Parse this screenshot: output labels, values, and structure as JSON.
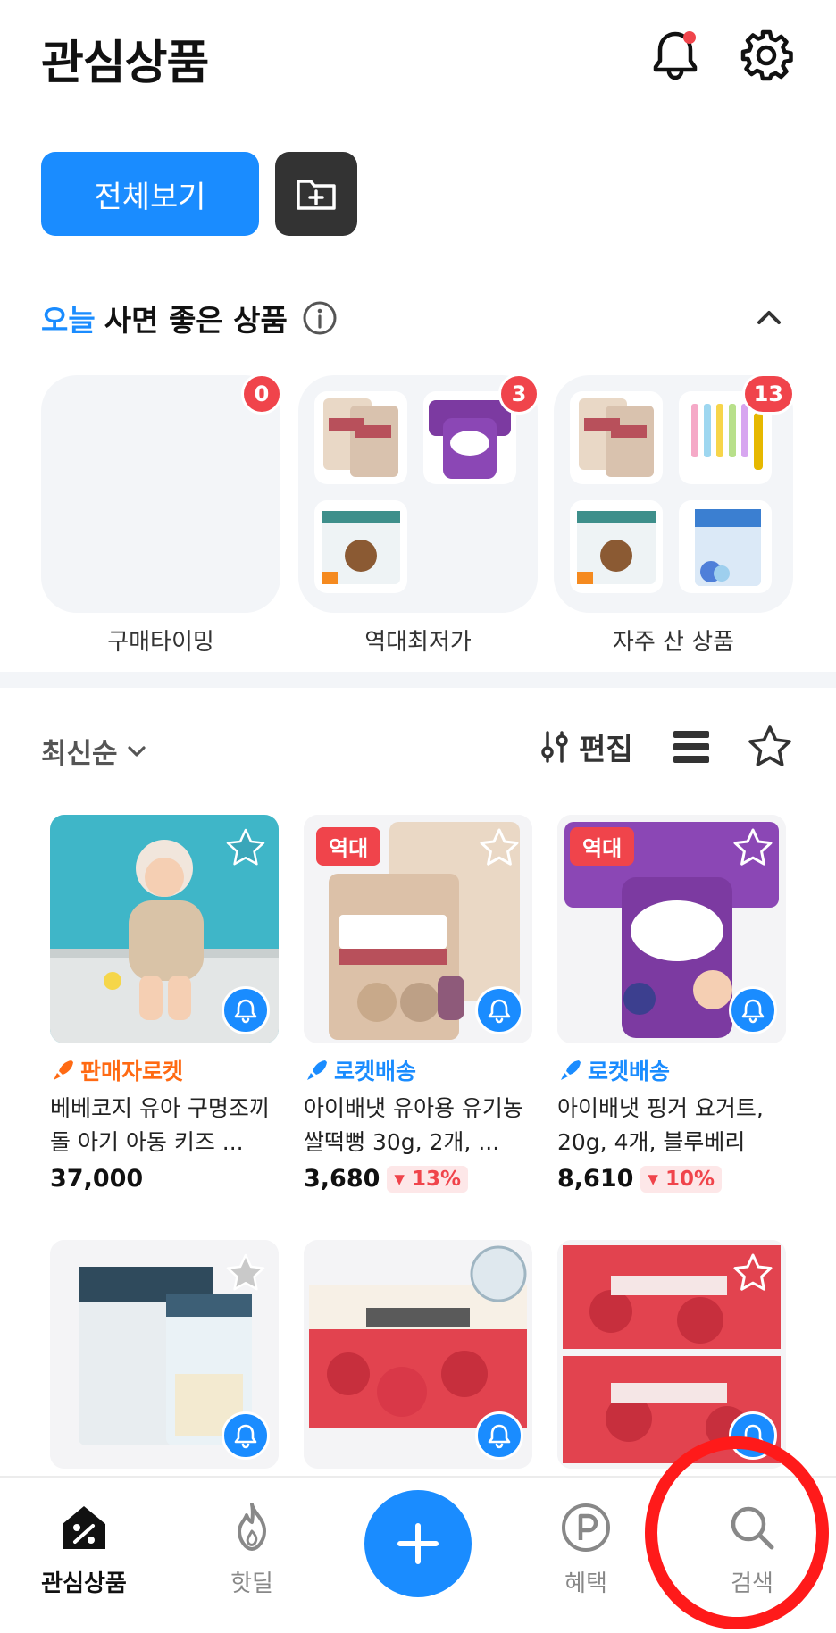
{
  "header": {
    "title": "관심상품",
    "notification_dot_color": "#f0444b"
  },
  "filters": {
    "all_label": "전체보기"
  },
  "today": {
    "title_accent": "오늘",
    "title_rest": "사면 좋은 상품",
    "cards": [
      {
        "label": "구매타이밍",
        "count": "0"
      },
      {
        "label": "역대최저가",
        "count": "3"
      },
      {
        "label": "자주 산 상품",
        "count": "13"
      }
    ]
  },
  "sortbar": {
    "sort_label": "최신순",
    "edit_label": "편집"
  },
  "products": [
    {
      "shipping": "판매자로켓",
      "shipping_color": "#ff6a13",
      "name": "베베코지 유아 구명조끼 돌 아기 아동 키즈 ...",
      "price": "37,000",
      "discount": "",
      "tag": ""
    },
    {
      "shipping": "로켓배송",
      "shipping_color": "#1a8cff",
      "name": "아이배냇 유아용 유기농 쌀떡뻥 30g, 2개, ...",
      "price": "3,680",
      "discount": "13%",
      "tag": "역대"
    },
    {
      "shipping": "로켓배송",
      "shipping_color": "#1a8cff",
      "name": "아이배냇 핑거 요거트, 20g, 4개, 블루베리",
      "price": "8,610",
      "discount": "10%",
      "tag": "역대"
    }
  ],
  "nav": {
    "items": [
      {
        "label": "관심상품"
      },
      {
        "label": "핫딜"
      },
      {
        "label": "혜택"
      },
      {
        "label": "검색"
      }
    ]
  }
}
